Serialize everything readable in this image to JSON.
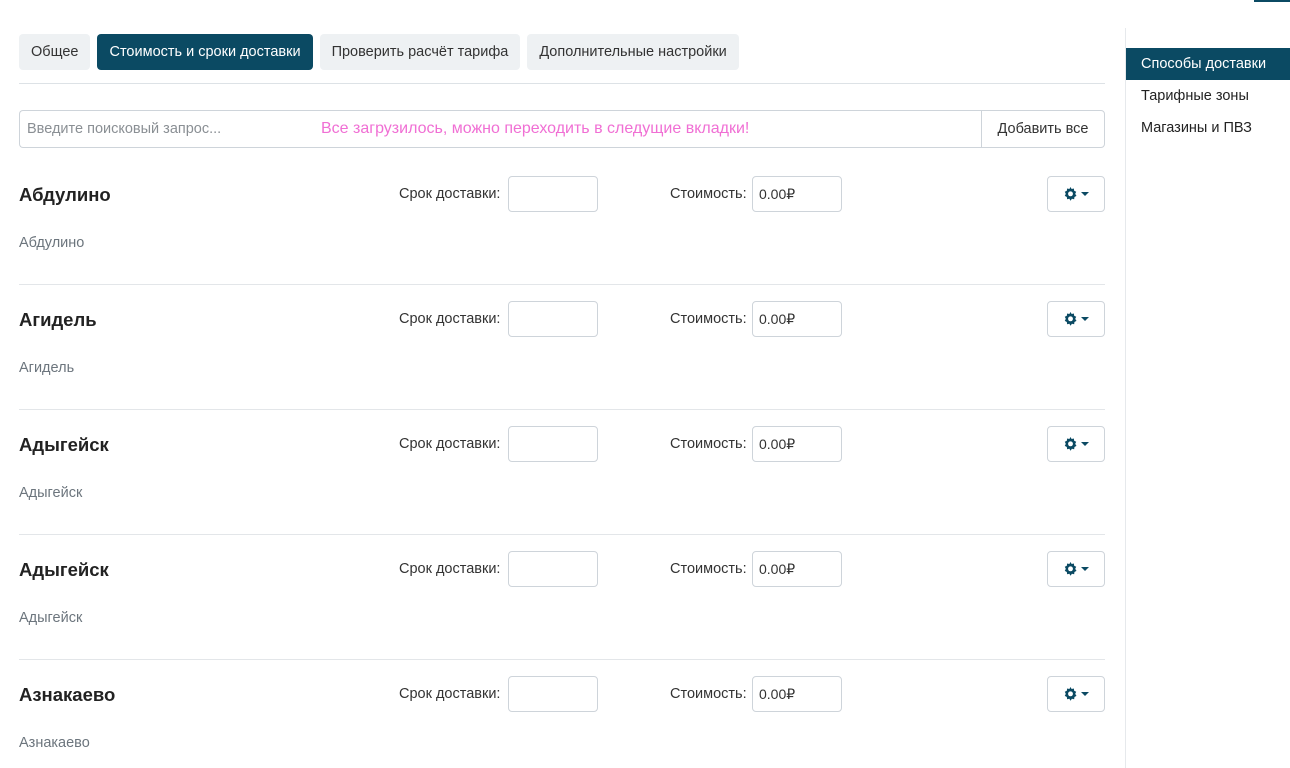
{
  "tabs": [
    {
      "label": "Общее",
      "active": false
    },
    {
      "label": "Стоимость и сроки доставки",
      "active": true
    },
    {
      "label": "Проверить расчёт тарифа",
      "active": false
    },
    {
      "label": "Дополнительные настройки",
      "active": false
    }
  ],
  "search": {
    "placeholder": "Введите поисковый запрос...",
    "value": "",
    "status_message": "Все загрузилось, можно переходить в следущие вкладки!",
    "add_all_label": "Добавить все"
  },
  "row_labels": {
    "term": "Срок доставки:",
    "cost": "Стоимость:"
  },
  "rows": [
    {
      "name": "Абдулино",
      "subtitle": "Абдулино",
      "term": "",
      "cost": "0.00₽"
    },
    {
      "name": "Агидель",
      "subtitle": "Агидель",
      "term": "",
      "cost": "0.00₽"
    },
    {
      "name": "Адыгейск",
      "subtitle": "Адыгейск",
      "term": "",
      "cost": "0.00₽"
    },
    {
      "name": "Адыгейск",
      "subtitle": "Адыгейск",
      "term": "",
      "cost": "0.00₽"
    },
    {
      "name": "Азнакаево",
      "subtitle": "Азнакаево",
      "term": "",
      "cost": "0.00₽"
    }
  ],
  "sidebar": {
    "items": [
      {
        "label": "Способы доставки",
        "active": true
      },
      {
        "label": "Тарифные зоны",
        "active": false
      },
      {
        "label": "Магазины и ПВЗ",
        "active": false
      }
    ]
  },
  "colors": {
    "accent": "#0b4a63",
    "status_message": "#f06fd4",
    "tab_inactive_bg": "#eef1f3"
  },
  "icons": {
    "row_action": "gear-icon",
    "row_action_caret": "caret-down-icon"
  }
}
